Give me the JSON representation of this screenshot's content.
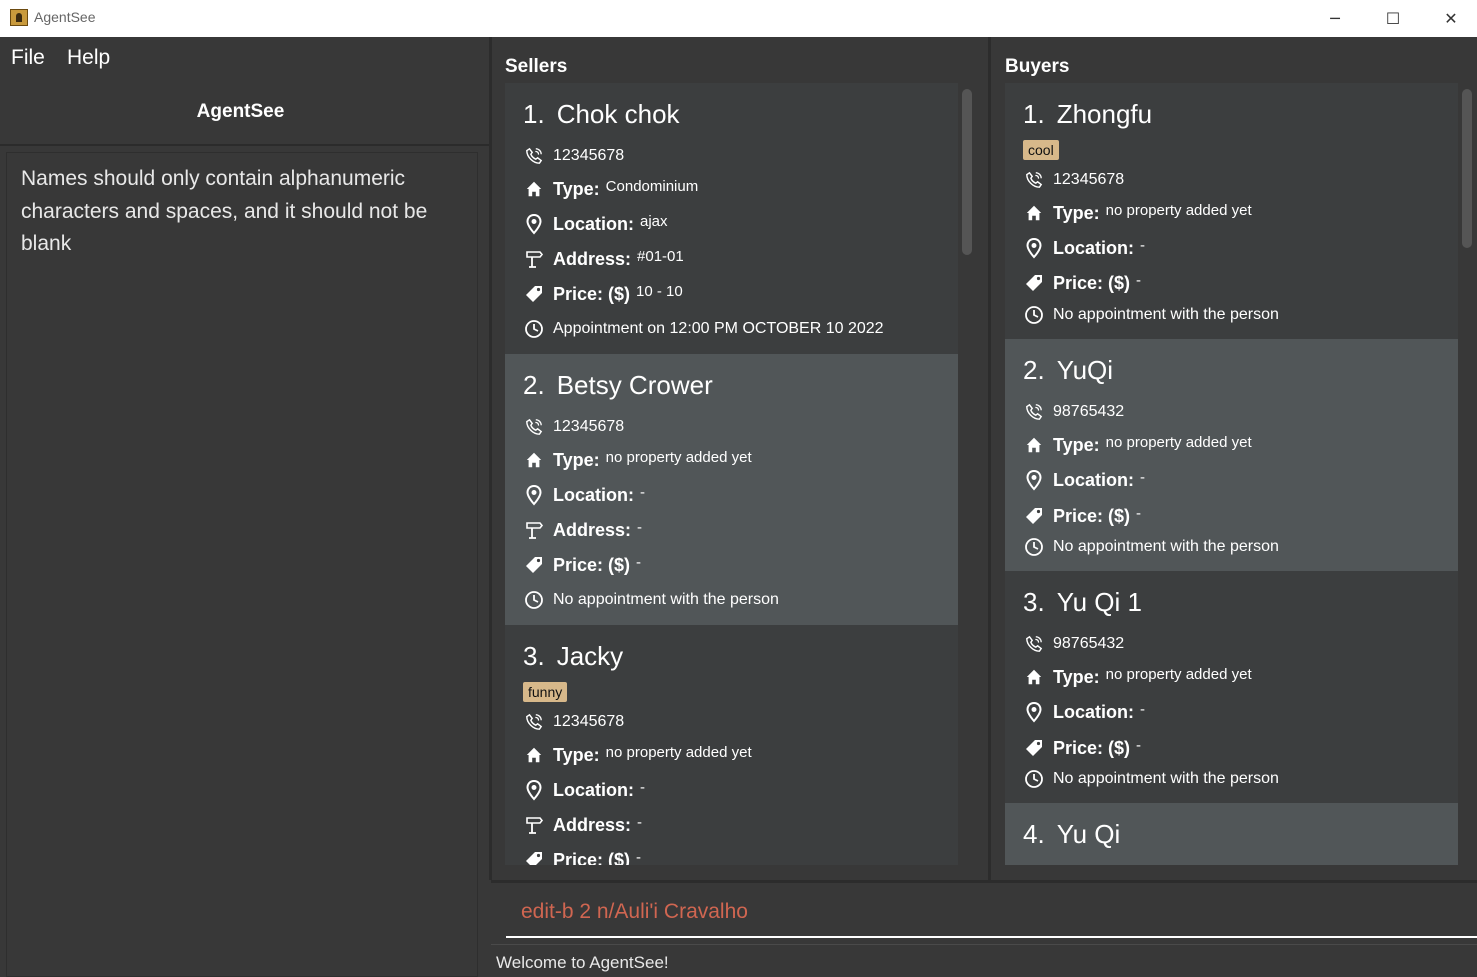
{
  "window": {
    "title": "AgentSee",
    "minimize_glyph": "─",
    "maximize_glyph": "☐",
    "close_glyph": "✕"
  },
  "menu": {
    "file": "File",
    "help": "Help"
  },
  "left": {
    "heading": "AgentSee",
    "result": "Names should only contain alphanumeric characters and spaces, and it should not be blank"
  },
  "sellers": {
    "title": "Sellers",
    "cards": [
      {
        "index": "1.",
        "name": "Chok chok",
        "phone": "12345678",
        "type_label": "Type:",
        "type": "Condominium",
        "location_label": "Location:",
        "location": "ajax",
        "address_label": "Address:",
        "address": "#01-01",
        "price_label": "Price: ($)",
        "price": "10  -  10",
        "appointment": "Appointment on 12:00 PM OCTOBER 10 2022"
      },
      {
        "index": "2.",
        "name": "Betsy Crower",
        "phone": "12345678",
        "type_label": "Type:",
        "type": "no property added yet",
        "location_label": "Location:",
        "location": "-",
        "address_label": "Address:",
        "address": "-",
        "price_label": "Price: ($)",
        "price": "-",
        "appointment": "No appointment with the person"
      },
      {
        "index": "3.",
        "name": "Jacky",
        "tag": "funny",
        "phone": "12345678",
        "type_label": "Type:",
        "type": "no property added yet",
        "location_label": "Location:",
        "location": "-",
        "address_label": "Address:",
        "address": "-",
        "price_label": "Price: ($)",
        "price": "-"
      }
    ]
  },
  "buyers": {
    "title": "Buyers",
    "cards": [
      {
        "index": "1.",
        "name": "Zhongfu",
        "tag": "cool",
        "phone": "12345678",
        "type_label": "Type:",
        "type": "no property added yet",
        "location_label": "Location:",
        "location": "-",
        "price_label": "Price: ($)",
        "price": "-",
        "appointment": "No appointment with the person"
      },
      {
        "index": "2.",
        "name": "YuQi",
        "phone": "98765432",
        "type_label": "Type:",
        "type": "no property added yet",
        "location_label": "Location:",
        "location": "-",
        "price_label": "Price: ($)",
        "price": "-",
        "appointment": "No appointment with the person"
      },
      {
        "index": "3.",
        "name": "Yu Qi 1",
        "phone": "98765432",
        "type_label": "Type:",
        "type": "no property added yet",
        "location_label": "Location:",
        "location": "-",
        "price_label": "Price: ($)",
        "price": "-",
        "appointment": "No appointment with the person"
      },
      {
        "index": "4.",
        "name": "Yu Qi"
      }
    ]
  },
  "command": {
    "value": "edit-b 2 n/Auli'i Cravalho"
  },
  "status": {
    "text": "Welcome to AgentSee!"
  },
  "colors": {
    "accent_tag": "#d7b88a",
    "command_text": "#d06651",
    "card_odd": "#3c3e3f",
    "card_even": "#515658"
  }
}
